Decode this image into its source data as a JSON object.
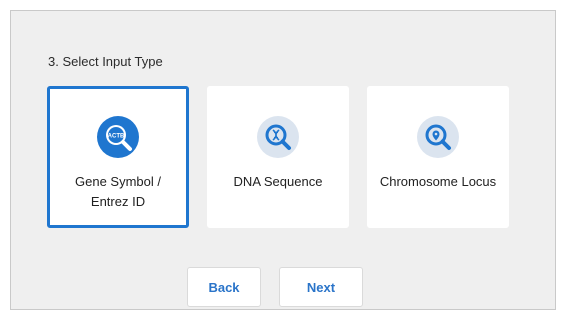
{
  "step": {
    "title": "3. Select Input Type"
  },
  "options": [
    {
      "label": "Gene Symbol / Entrez ID",
      "icon": "gene-search-icon",
      "icon_text": "ACTB",
      "selected": true
    },
    {
      "label": "DNA Sequence",
      "icon": "dna-search-icon",
      "selected": false
    },
    {
      "label": "Chromosome Locus",
      "icon": "location-search-icon",
      "selected": false
    }
  ],
  "buttons": {
    "back": "Back",
    "next": "Next"
  },
  "colors": {
    "accent": "#1f76cf",
    "icon_bg_light": "#dbe4ef",
    "panel_bg": "#efefef"
  }
}
